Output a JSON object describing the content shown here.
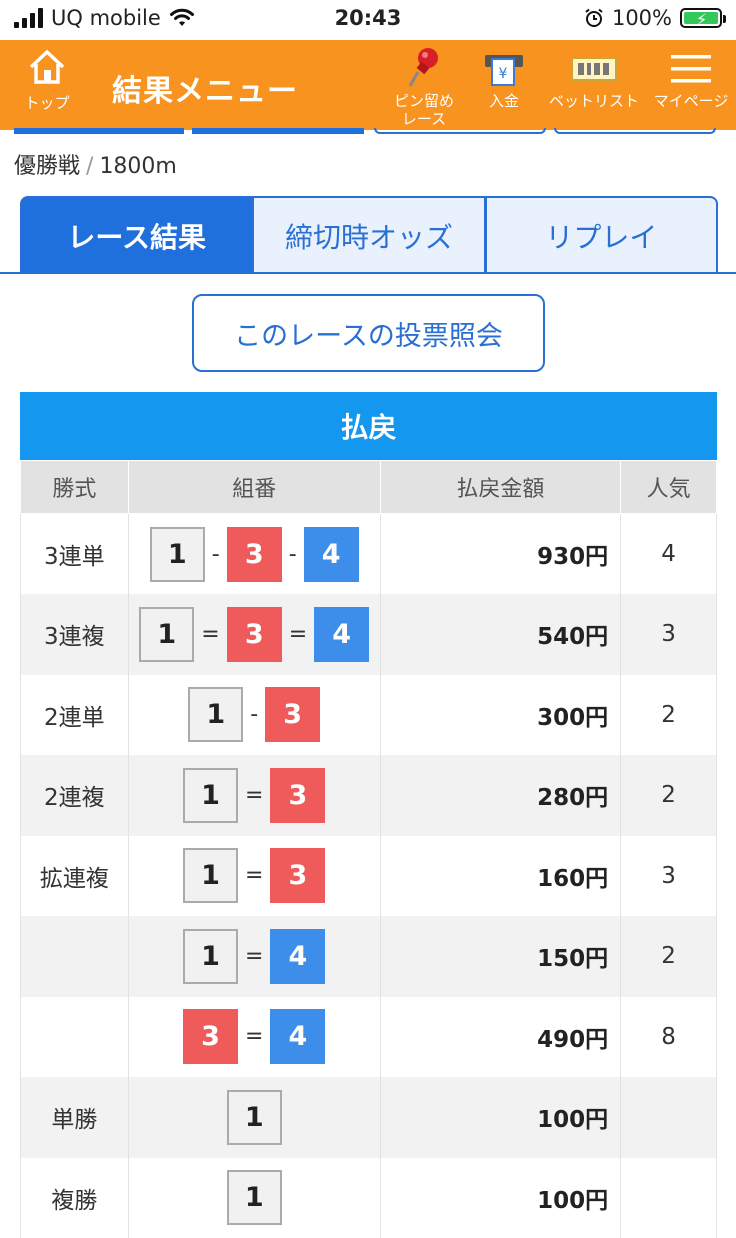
{
  "status": {
    "carrier": "UQ mobile",
    "time": "20:43",
    "battery": "100%"
  },
  "header": {
    "home_label": "トップ",
    "title": "結果メニュー",
    "pin_label_1": "ピン留め",
    "pin_label_2": "レース",
    "deposit_label": "入金",
    "betlist_label": "ベットリスト",
    "mypage_label": "マイページ",
    "deposit_icon_text": "¥"
  },
  "race": {
    "name": "優勝戦",
    "separator": "/",
    "distance": "1800m"
  },
  "tabs": [
    {
      "label": "レース結果",
      "active": true
    },
    {
      "label": "締切時オッズ",
      "active": false
    },
    {
      "label": "リプレイ",
      "active": false
    }
  ],
  "vote_button": "このレースの投票照会",
  "payout": {
    "title": "払戻",
    "headers": [
      "勝式",
      "組番",
      "払戻金額",
      "人気"
    ],
    "rows": [
      {
        "kind": "3連単",
        "nums": [
          "1",
          "3",
          "4"
        ],
        "sep": "-",
        "amount": "930円",
        "pop": "4"
      },
      {
        "kind": "3連複",
        "nums": [
          "1",
          "3",
          "4"
        ],
        "sep": "=",
        "amount": "540円",
        "pop": "3"
      },
      {
        "kind": "2連単",
        "nums": [
          "1",
          "3"
        ],
        "sep": "-",
        "amount": "300円",
        "pop": "2"
      },
      {
        "kind": "2連複",
        "nums": [
          "1",
          "3"
        ],
        "sep": "=",
        "amount": "280円",
        "pop": "2"
      },
      {
        "kind": "拡連複",
        "nums": [
          "1",
          "3"
        ],
        "sep": "=",
        "amount": "160円",
        "pop": "3"
      },
      {
        "kind": "",
        "nums": [
          "1",
          "4"
        ],
        "sep": "=",
        "amount": "150円",
        "pop": "2"
      },
      {
        "kind": "",
        "nums": [
          "3",
          "4"
        ],
        "sep": "=",
        "amount": "490円",
        "pop": "8"
      },
      {
        "kind": "単勝",
        "nums": [
          "1"
        ],
        "sep": "",
        "amount": "100円",
        "pop": ""
      },
      {
        "kind": "複勝",
        "nums": [
          "1"
        ],
        "sep": "",
        "amount": "100円",
        "pop": ""
      }
    ]
  },
  "colors": {
    "header": "#f7931e",
    "primary": "#1f6fdc",
    "boat1": "#f1f1f1",
    "boat3": "#ef5b5b",
    "boat4": "#3d8eea"
  }
}
